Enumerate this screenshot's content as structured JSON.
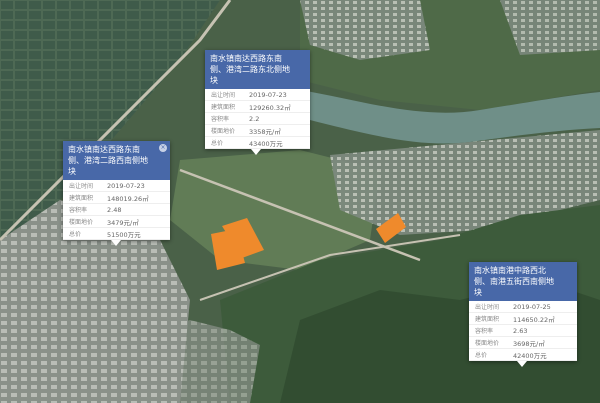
{
  "map": {
    "colors": {
      "parcel": "#ef8a2c",
      "popup_header": "#4868a8",
      "river": "#6f8f88",
      "mountain": "#3d5b3b"
    },
    "parcels": [
      {
        "title": "南水镇南达西路东南侧、港湾二路东北侧地块",
        "rows": [
          {
            "label": "出让时间",
            "value": "2019-07-23"
          },
          {
            "label": "建筑面积",
            "value": "129260.32㎡"
          },
          {
            "label": "容积率",
            "value": "2.2"
          },
          {
            "label": "楼面地价",
            "value": "3358元/㎡"
          },
          {
            "label": "总价",
            "value": "43400万元"
          }
        ]
      },
      {
        "title": "南水镇南达西路东南侧、港湾二路西南侧地块",
        "rows": [
          {
            "label": "出让时间",
            "value": "2019-07-23"
          },
          {
            "label": "建筑面积",
            "value": "148019.26㎡"
          },
          {
            "label": "容积率",
            "value": "2.48"
          },
          {
            "label": "楼面地价",
            "value": "3479元/㎡"
          },
          {
            "label": "总价",
            "value": "51500万元"
          }
        ]
      },
      {
        "title": "南水镇南港中路西北侧、南港五街西南侧地块",
        "rows": [
          {
            "label": "出让时间",
            "value": "2019-07-25"
          },
          {
            "label": "建筑面积",
            "value": "114650.22㎡"
          },
          {
            "label": "容积率",
            "value": "2.63"
          },
          {
            "label": "楼面地价",
            "value": "3698元/㎡"
          },
          {
            "label": "总价",
            "value": "42400万元"
          }
        ]
      }
    ]
  }
}
